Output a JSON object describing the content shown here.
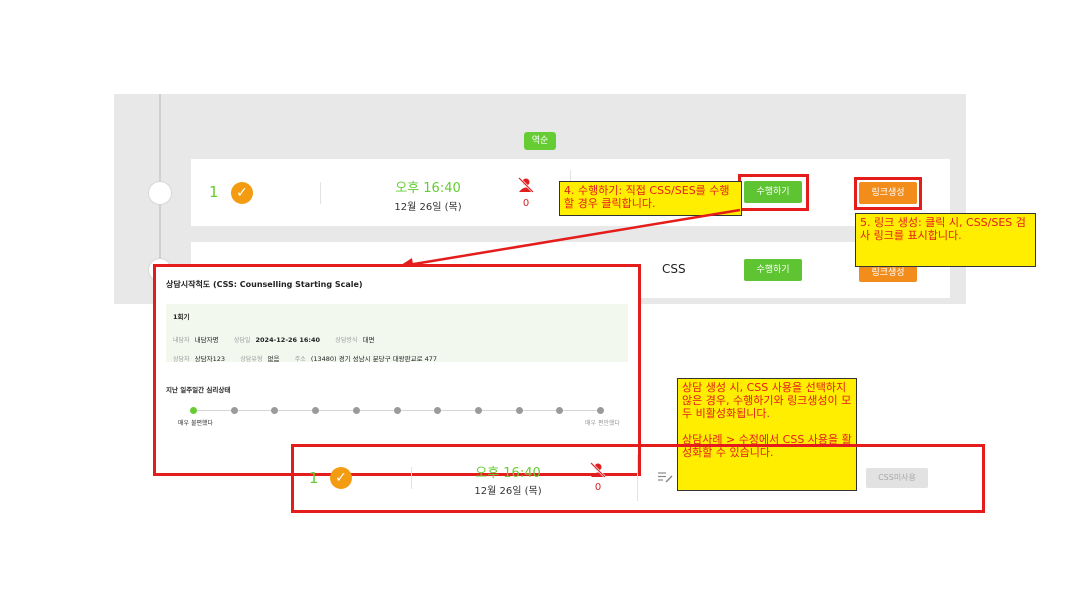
{
  "panel": {
    "date_chip": "역순",
    "row1": {
      "number": "1",
      "time": "오후 16:40",
      "date": "12월 26일 (목)",
      "absent_count": "0",
      "perform_button": "수행하기",
      "link_button": "링크생성"
    },
    "row2": {
      "css_label": "CSS",
      "perform_button": "수행하기",
      "link_button": "링크생성"
    }
  },
  "notes": {
    "perform": "4. 수행하기: 직접 CSS/SES를 수행할 경우 클릭합니다.",
    "link": "5. 링크 생성: 클릭 시, CSS/SES 검사 링크를 표시합니다.",
    "disabled_line1": "상담 생성 시, CSS 사용을 선택하지 않은 경우, 수행하기와 링크생성이 모두 비활성화됩니다.",
    "disabled_line2": "상담사례 > 수정에서 CSS 사용을 활성화할 수 있습니다."
  },
  "css_modal": {
    "title": "상담시작척도 (CSS: Counselling Starting Scale)",
    "session": "1회기",
    "fields": [
      {
        "label": "내담자",
        "value": "내담자명"
      },
      {
        "label": "상담일",
        "value": "2024-12-26 16:40"
      },
      {
        "label": "상담방식",
        "value": "대면"
      },
      {
        "label": "상담자",
        "value": "상담자123"
      },
      {
        "label": "상담유형",
        "value": "없음"
      },
      {
        "label": "주소",
        "value": "(13480) 경기 성남시 분당구 대왕판교로 477"
      }
    ],
    "question": "지난 일주일간 심리상태",
    "scale_left": "매우 불편했다",
    "scale_right": "매우 편안했다",
    "scale_points": 11,
    "scale_selected": 1
  },
  "disabled_row": {
    "number": "1",
    "time": "오후 16:40",
    "date": "12월 26일 (목)",
    "absent_count": "0",
    "css_disabled_button": "CSS미사용"
  },
  "colors": {
    "accent_green": "#5ec432",
    "accent_orange": "#f28c1b",
    "highlight_red": "#e41c1c",
    "note_yellow": "#ffee00"
  }
}
